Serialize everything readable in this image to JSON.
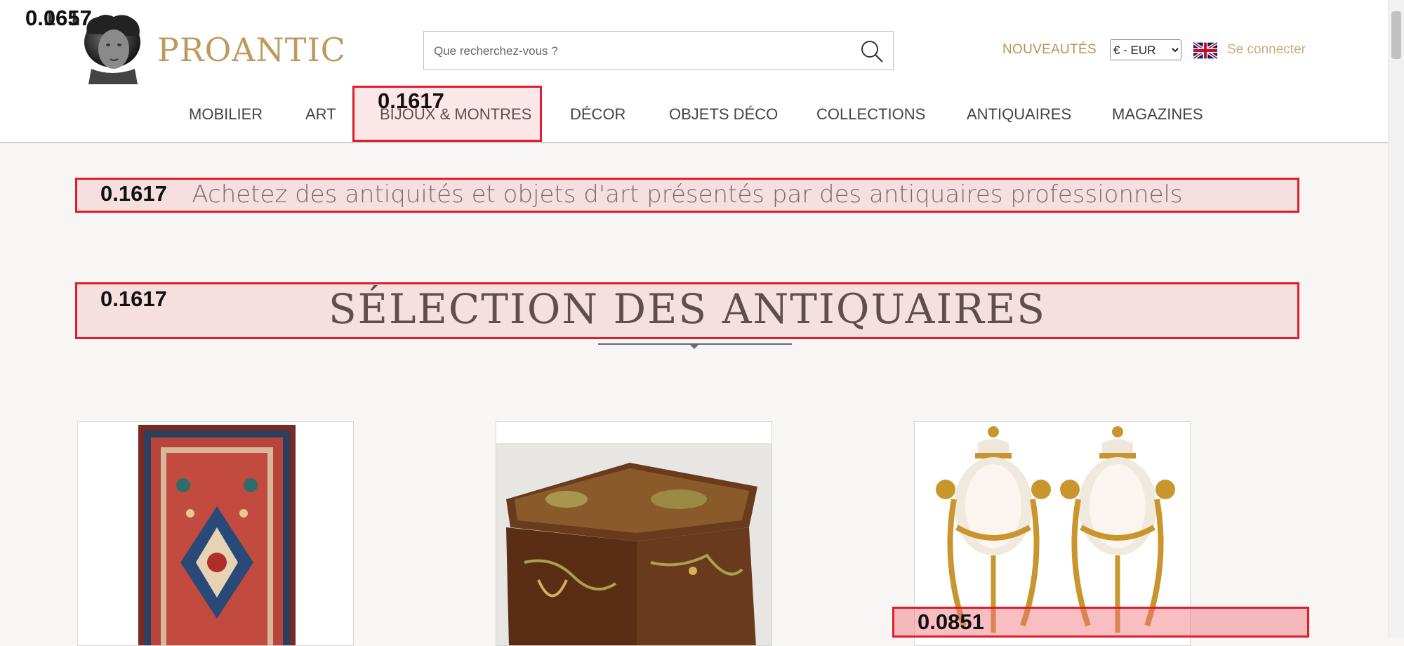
{
  "header": {
    "brand": "PROANTIC",
    "search": {
      "placeholder": "Que recherchez-vous ?",
      "value": ""
    },
    "new_link": "NOUVEAUTÉS",
    "currency": {
      "selected": "€ - EUR"
    },
    "language": "English",
    "login": "Se connecter"
  },
  "nav": [
    "MOBILIER",
    "ART",
    "BIJOUX & MONTRES",
    "DÉCOR",
    "OBJETS DÉCO",
    "COLLECTIONS",
    "ANTIQUAIRES",
    "MAGAZINES"
  ],
  "main": {
    "tagline": "Achetez des antiquités et objets d'art présentés par des antiquaires professionnels",
    "section_title": "SÉLECTION DES ANTIQUAIRES",
    "products": [
      {
        "image": "persian-rug"
      },
      {
        "image": "marquetry-box"
      },
      {
        "image": "alabaster-vases-pair"
      }
    ]
  },
  "overlays": {
    "corner": [
      "0.0657",
      "0.1617"
    ],
    "nav_box": "0.1617",
    "tagline_box": "0.1617",
    "title_box": "0.1617",
    "card_box": "0.0851"
  },
  "colors": {
    "brand": "#bd9a5c",
    "nav_text": "#444444",
    "annotation": "#e11d2b"
  }
}
